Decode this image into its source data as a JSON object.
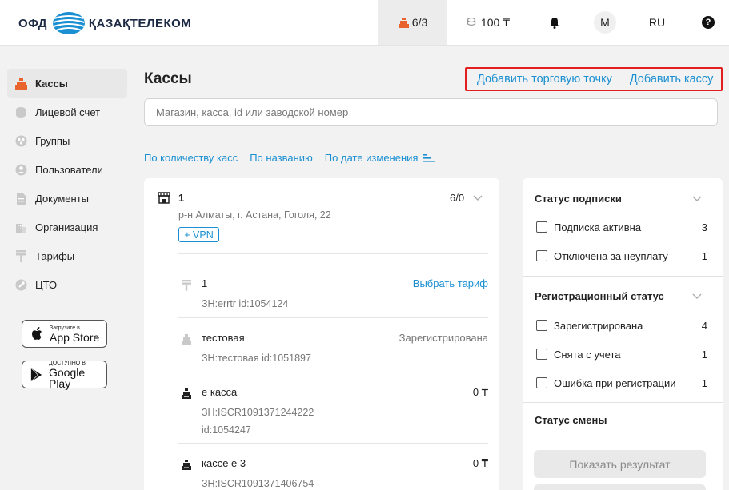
{
  "header": {
    "logo_ofd": "ОФД",
    "logo_company": "ҚАЗАҚТЕЛЕКОМ",
    "kassy_counter": "6/3",
    "balance": "100 ₸",
    "avatar_letter": "M",
    "language": "RU",
    "help": "?"
  },
  "sidebar": {
    "items": [
      {
        "label": "Кассы",
        "icon": "cash-register-icon"
      },
      {
        "label": "Лицевой счет",
        "icon": "coins-icon"
      },
      {
        "label": "Группы",
        "icon": "groups-icon"
      },
      {
        "label": "Пользователи",
        "icon": "user-icon"
      },
      {
        "label": "Документы",
        "icon": "document-icon"
      },
      {
        "label": "Организация",
        "icon": "building-icon"
      },
      {
        "label": "Тарифы",
        "icon": "tariff-icon"
      },
      {
        "label": "ЦТО",
        "icon": "wrench-icon"
      }
    ],
    "app_store": {
      "small": "Загрузите в",
      "big": "App Store"
    },
    "google_play": {
      "small": "ДОСТУПНО В",
      "big": "Google Play"
    }
  },
  "main": {
    "title": "Кассы",
    "add_point": "Добавить торговую точку",
    "add_kassa": "Добавить кассу",
    "search_placeholder": "Магазин, касса, id или заводской номер",
    "sort": [
      "По количеству касс",
      "По названию",
      "По дате изменения"
    ]
  },
  "store": {
    "name": "1",
    "count": "6/0",
    "address": "р-н Алматы, г. Астана, Гоголя, 22",
    "vpn_label": "+ VPN"
  },
  "kassas": [
    {
      "name": "1",
      "meta1": "ЗН:errtr  id:1054124",
      "meta2": "",
      "right": "Выбрать тариф"
    },
    {
      "name": "тестовая",
      "meta1": "ЗН:тестовая  id:1051897",
      "meta2": "",
      "right": "Зарегистрирована"
    },
    {
      "name": "е касса",
      "meta1": "ЗН:ISCR1091371244222",
      "meta2": "id:1054247",
      "right": "0 ₸"
    },
    {
      "name": "кассе е 3",
      "meta1": "ЗН:ISCR1091371406754",
      "meta2": "",
      "right": "0 ₸"
    }
  ],
  "filters": {
    "subscription": {
      "title": "Статус подписки",
      "items": [
        {
          "label": "Подписка активна",
          "count": "3"
        },
        {
          "label": "Отключена за неуплату",
          "count": "1"
        }
      ]
    },
    "registration": {
      "title": "Регистрационный статус",
      "items": [
        {
          "label": "Зарегистрирована",
          "count": "4"
        },
        {
          "label": "Снята с учета",
          "count": "1"
        },
        {
          "label": "Ошибка при регистрации",
          "count": "1"
        }
      ]
    },
    "shift": {
      "title": "Статус смены"
    },
    "show_result": "Показать результат"
  },
  "colors": {
    "accent": "#1a8fd1",
    "orange": "#e8642c",
    "highlight_border": "#e21e1e"
  }
}
